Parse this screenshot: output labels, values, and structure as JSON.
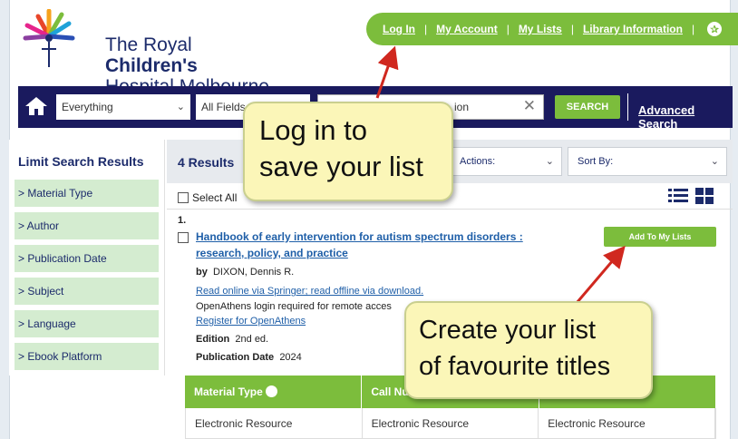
{
  "logo": {
    "line1_regular": "The Royal ",
    "line1_bold": "Children's",
    "line2": "Hospital Melbourne"
  },
  "topnav": {
    "login": "Log In",
    "my_account": "My Account",
    "my_lists": "My Lists",
    "library_info": "Library Information",
    "sep": "|"
  },
  "search": {
    "scope": "Everything",
    "field": "All Fields",
    "query_visible": "ion",
    "button": "SEARCH",
    "advanced": "Advanced Search"
  },
  "sidebar": {
    "title": "Limit Search Results",
    "facets": [
      "> Material Type",
      "> Author",
      "> Publication Date",
      "> Subject",
      "> Language",
      "> Ebook Platform"
    ]
  },
  "results": {
    "count": "4 Results",
    "actions": "Actions:",
    "sort": "Sort By:",
    "select_all": "Select All"
  },
  "item": {
    "num": "1.",
    "title": "Handbook of early intervention for autism spectrum disorders : research, policy, and practice",
    "add_button": "Add To My Lists",
    "by_label": "by",
    "author": "DIXON, Dennis R.",
    "online_link": "Read online via Springer; read offline via download.",
    "openathens_note": "OpenAthens login required for remote acces",
    "register_link": "Register for OpenAthens",
    "edition_label": "Edition",
    "edition": "2nd ed.",
    "pubdate_label": "Publication Date",
    "pubdate": "2024"
  },
  "table": {
    "headers": [
      "Material Type",
      "Call Numb",
      ""
    ],
    "row": [
      "Electronic Resource",
      "Electronic Resource",
      "Electronic Resource"
    ]
  },
  "callouts": {
    "login_line1": "Log in to",
    "login_line2": "save your list",
    "list_line1": "Create your list",
    "list_line2": "of favourite titles"
  },
  "colors": {
    "green": "#7cbd3c",
    "navy": "#1a1a5e",
    "callout": "#fbf6b8",
    "arrow": "#d0281f"
  }
}
